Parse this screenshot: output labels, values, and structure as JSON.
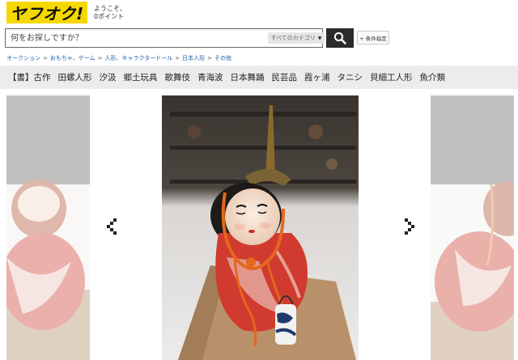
{
  "header": {
    "logo_text": "ヤフオク!",
    "welcome_line1": "ようこそ、",
    "welcome_line2": "0ポイント"
  },
  "search": {
    "placeholder": "何をお探しですか？",
    "category_label": "すべてのカテゴリ",
    "search_icon": "search-icon",
    "conditions_label": "+ 条件指定"
  },
  "breadcrumb": [
    "オークション",
    "おもちゃ、ゲーム",
    "人形、キャラクタードール",
    "日本人形",
    "その他"
  ],
  "tags": [
    "【書】古作",
    "田螺人形",
    "汐汲",
    "郷土玩具",
    "歌舞伎",
    "青海波",
    "日本舞踊",
    "民芸品",
    "霞ヶ浦",
    "タニシ",
    "貝細工人形",
    "魚介類"
  ],
  "carousel": {
    "prev_icon": "chevron-left-icon",
    "next_icon": "chevron-right-icon"
  },
  "colors": {
    "logo_bg": "#f5d800",
    "search_button_bg": "#2b2b2b",
    "link": "#1c5fa8",
    "tagbar_bg": "#ececec"
  }
}
